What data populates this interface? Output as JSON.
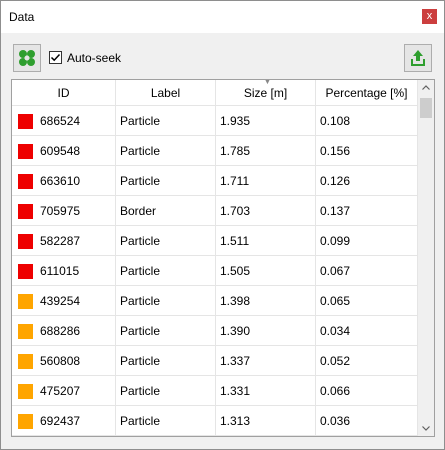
{
  "window": {
    "title": "Data",
    "close_label": "x"
  },
  "toolbar": {
    "seek_icon": "green-clover-icon",
    "auto_seek_label": "Auto-seek",
    "auto_seek_checked": true,
    "export_icon": "export-upload-icon"
  },
  "table": {
    "columns": [
      "ID",
      "Label",
      "Size [m]",
      "Percentage [%]"
    ],
    "sorted_column": "Size [m]",
    "rows": [
      {
        "color": "#ee0000",
        "id": "686524",
        "label": "Particle",
        "size": "1.935",
        "pct": "0.108"
      },
      {
        "color": "#ee0000",
        "id": "609548",
        "label": "Particle",
        "size": "1.785",
        "pct": "0.156"
      },
      {
        "color": "#ee0000",
        "id": "663610",
        "label": "Particle",
        "size": "1.711",
        "pct": "0.126"
      },
      {
        "color": "#ee0000",
        "id": "705975",
        "label": "Border",
        "size": "1.703",
        "pct": "0.137"
      },
      {
        "color": "#ee0000",
        "id": "582287",
        "label": "Particle",
        "size": "1.511",
        "pct": "0.099"
      },
      {
        "color": "#ee0000",
        "id": "611015",
        "label": "Particle",
        "size": "1.505",
        "pct": "0.067"
      },
      {
        "color": "#ffa500",
        "id": "439254",
        "label": "Particle",
        "size": "1.398",
        "pct": "0.065"
      },
      {
        "color": "#ffa500",
        "id": "688286",
        "label": "Particle",
        "size": "1.390",
        "pct": "0.034"
      },
      {
        "color": "#ffa500",
        "id": "560808",
        "label": "Particle",
        "size": "1.337",
        "pct": "0.052"
      },
      {
        "color": "#ffa500",
        "id": "475207",
        "label": "Particle",
        "size": "1.331",
        "pct": "0.066"
      },
      {
        "color": "#ffa500",
        "id": "692437",
        "label": "Particle",
        "size": "1.313",
        "pct": "0.036"
      }
    ]
  }
}
